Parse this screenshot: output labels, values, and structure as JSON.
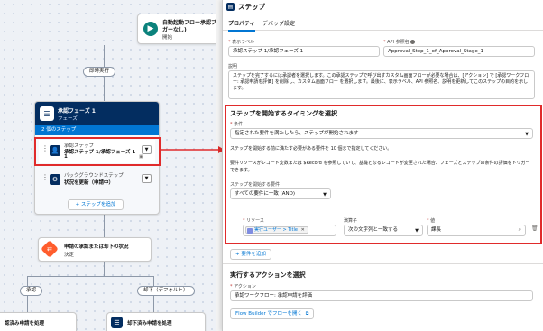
{
  "canvas": {
    "start_node": {
      "title": "自動起動フロー承認プ",
      "title_suffix": "ガーなし)",
      "subtitle": "開始"
    },
    "branch_pill_top": "即時実行",
    "stage": {
      "title": "承認フェーズ 1",
      "type": "フェーズ",
      "steps_count": "2 個のステップ",
      "steps": [
        {
          "type_label": "承認ステップ",
          "name": "承認ステップ 1/承認フェーズ 1",
          "name_line2": "1"
        },
        {
          "type_label": "バックグラウンドステップ",
          "name": "状況を更新（申請中）"
        }
      ],
      "add_step_label": "+ ステップを追加"
    },
    "decision": {
      "title": "申請の承認または却下の状況",
      "subtitle": "決定"
    },
    "branches": {
      "left": "承認",
      "right": "却下（デフォルト）"
    },
    "bottom_nodes": {
      "left": "認済み申請を処理",
      "right": "却下済み申請を処理"
    }
  },
  "panel": {
    "title": "ステップ",
    "tabs": [
      {
        "label": "プロパティ",
        "active": true
      },
      {
        "label": "デバッグ設定",
        "active": false
      }
    ],
    "label_field": {
      "label": "表示ラベル",
      "value": "承認ステップ 1/承認フェーズ 1"
    },
    "api_field": {
      "label": "API 参照名",
      "value": "Approval_Step_1_of_Approval_Stage_1"
    },
    "description": {
      "label": "説明",
      "value": "ステップを完了するには承認者を選択します。この承認ステップで呼び出すカスタム画面フローが必要な場合は、[アクション] で [承認ワークフロー: 承認申請を評価] を削除し、カスタム画面フロー を選択します。最後に、表示ラベル、API 参照名、説明を更新してこのステップの目的を示します。"
    },
    "timing": {
      "title": "ステップを開始するタイミングを選択",
      "condition_label": "条件",
      "condition_value": "指定された要件を満たしたら、ステップが開始されます",
      "help1": "ステップを開始する前に満たす必要がある要件を 10 個まで指定してください。",
      "help2": "要件リソースがレコード変数または $Record を参照していて、基礎となるレコードが変更された場合、フェーズとステップの条件の評価をトリガーできます。",
      "logic_label": "ステップを開始する要件",
      "logic_value": "すべての要件に一致 (AND)",
      "resource_label": "リソース",
      "resource_value": "実行ユーザー > Title",
      "operator_label": "演算子",
      "operator_value": "次の文字列と一致する",
      "value_label": "値",
      "value_value": "課長",
      "add_requirement": "+ 要件を追加"
    },
    "action_section": {
      "title": "実行するアクションを選択",
      "action_label": "アクション",
      "action_value": "承認ワークフロー: 承認申請を評価",
      "open_builder": "Flow Builder でフローを開く"
    }
  },
  "colors": {
    "highlight": "#e02b2b",
    "brand": "#0176d3",
    "stage_header": "#032d60",
    "decision": "#ff5d2d"
  }
}
